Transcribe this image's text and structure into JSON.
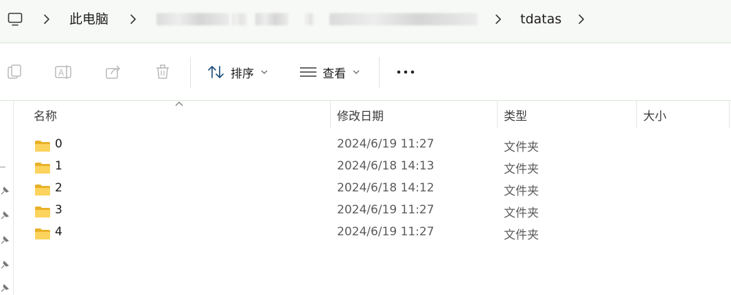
{
  "address": {
    "root_label": "此电脑",
    "current_folder": "tdatas"
  },
  "toolbar": {
    "sort_label": "排序",
    "view_label": "查看",
    "more_label": "..."
  },
  "columns": {
    "name": "名称",
    "date": "修改日期",
    "type": "类型",
    "size": "大小"
  },
  "files": [
    {
      "name": "0",
      "date": "2024/6/19 11:27",
      "type": "文件夹",
      "size": ""
    },
    {
      "name": "1",
      "date": "2024/6/18 14:13",
      "type": "文件夹",
      "size": ""
    },
    {
      "name": "2",
      "date": "2024/6/18 14:12",
      "type": "文件夹",
      "size": ""
    },
    {
      "name": "3",
      "date": "2024/6/19 11:27",
      "type": "文件夹",
      "size": ""
    },
    {
      "name": "4",
      "date": "2024/6/19 11:27",
      "type": "文件夹",
      "size": ""
    }
  ],
  "icons": {
    "pc": "computer-icon",
    "copy": "copy-icon",
    "rename": "rename-icon",
    "share": "share-icon",
    "delete": "delete-icon",
    "sort": "sort-icon",
    "view": "view-icon",
    "folder": "folder-icon",
    "pin": "pin-icon"
  },
  "colors": {
    "address_bg": "#f7f9f6",
    "accent_line": "#d8e4d5",
    "folder_yellow": "#f4c542"
  }
}
